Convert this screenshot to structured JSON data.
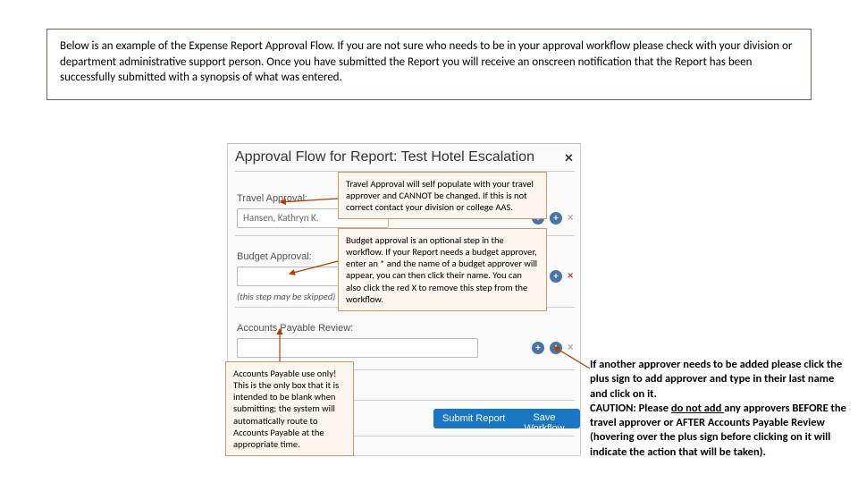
{
  "intro": "Below is an example of the Expense Report Approval Flow.  If you are not sure who needs to be in your approval workflow please check with your division or department administrative support person.  Once you have submitted the Report you will receive an onscreen notification that the Report has been successfully submitted with a synopsis of what was entered.",
  "dialog": {
    "title": "Approval Flow for Report: Test Hotel Escalation",
    "row1": {
      "label": "Travel Approval:",
      "value": "Hansen, Kathryn K."
    },
    "row2": {
      "label": "Budget Approval:",
      "note": "(this step may be skipped)"
    },
    "row3": {
      "label": "Accounts Payable Review:"
    },
    "buttons": {
      "submit": "Submit Report",
      "save": "Save Workflow"
    }
  },
  "callouts": {
    "travel": "Travel Approval will self populate with your travel approver and CANNOT be changed.  If this is not correct contact your division or college AAS.",
    "budget": "Budget approval is an optional step in the workflow.  If your Report needs a budget approver, enter an * and the name of a budget approver will appear, you can then click their name.  You can also click the red X to remove this step from the workflow.",
    "ap": "Accounts Payable use only!  This is the only box that it is intended to be blank when submitting; the system will automatically route to Accounts Payable at the appropriate time.",
    "plus_pre": "If another approver needs to be added please click the plus sign to add approver and type in their last name and click on it.",
    "plus_caution_label": "CAUTION: Please ",
    "plus_caution_underline": "do not add ",
    "plus_caution_rest": "any approvers BEFORE the travel approver or AFTER Accounts Payable Review (hovering over the plus sign before clicking on it will indicate the action that will be taken)."
  }
}
